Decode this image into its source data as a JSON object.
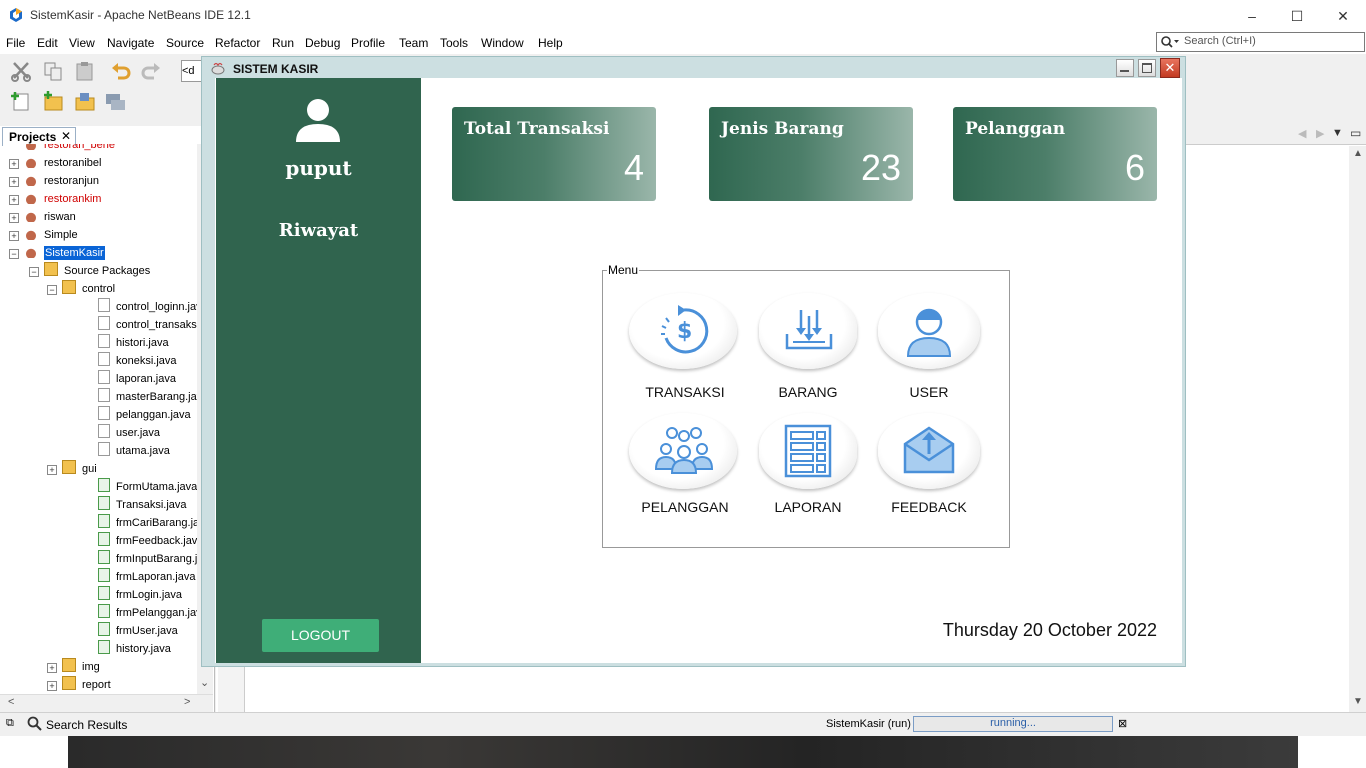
{
  "ide": {
    "title": "SistemKasir - Apache NetBeans IDE 12.1",
    "menu": [
      "File",
      "Edit",
      "View",
      "Navigate",
      "Source",
      "Refactor",
      "Run",
      "Debug",
      "Profile",
      "Team",
      "Tools",
      "Window",
      "Help"
    ],
    "search_placeholder": "Search (Ctrl+I)",
    "toolbar_combo": "<d",
    "projects_tab": "Projects",
    "tree": [
      {
        "label": "restoran_bene",
        "kind": "project",
        "color": "#d00000"
      },
      {
        "label": "restoranibel",
        "kind": "project",
        "color": "#000000"
      },
      {
        "label": "restoranjun",
        "kind": "project",
        "color": "#000000"
      },
      {
        "label": "restorankim",
        "kind": "project-error",
        "color": "#d00000"
      },
      {
        "label": "riswan",
        "kind": "project",
        "color": "#000000"
      },
      {
        "label": "Simple",
        "kind": "project",
        "color": "#000000"
      },
      {
        "label": "SistemKasir",
        "kind": "project-selected",
        "color": "#ffffff"
      },
      {
        "label": "Source Packages",
        "kind": "source",
        "color": "#000000"
      },
      {
        "label": "control",
        "kind": "package",
        "color": "#000000"
      },
      {
        "label": "control_loginn.java",
        "kind": "java",
        "color": "#000000"
      },
      {
        "label": "control_transaksi.ja",
        "kind": "java",
        "color": "#000000"
      },
      {
        "label": "histori.java",
        "kind": "java",
        "color": "#000000"
      },
      {
        "label": "koneksi.java",
        "kind": "java",
        "color": "#000000"
      },
      {
        "label": "laporan.java",
        "kind": "java",
        "color": "#000000"
      },
      {
        "label": "masterBarang.java",
        "kind": "java",
        "color": "#000000"
      },
      {
        "label": "pelanggan.java",
        "kind": "java",
        "color": "#000000"
      },
      {
        "label": "user.java",
        "kind": "java",
        "color": "#000000"
      },
      {
        "label": "utama.java",
        "kind": "java",
        "color": "#000000"
      },
      {
        "label": "gui",
        "kind": "package",
        "color": "#000000"
      },
      {
        "label": "FormUtama.java",
        "kind": "form",
        "color": "#000000"
      },
      {
        "label": "Transaksi.java",
        "kind": "form",
        "color": "#000000"
      },
      {
        "label": "frmCariBarang.java",
        "kind": "form",
        "color": "#000000"
      },
      {
        "label": "frmFeedback.java",
        "kind": "form",
        "color": "#000000"
      },
      {
        "label": "frmInputBarang.jav",
        "kind": "form",
        "color": "#000000"
      },
      {
        "label": "frmLaporan.java",
        "kind": "form",
        "color": "#000000"
      },
      {
        "label": "frmLogin.java",
        "kind": "form",
        "color": "#000000"
      },
      {
        "label": "frmPelanggan.java",
        "kind": "form",
        "color": "#000000"
      },
      {
        "label": "frmUser.java",
        "kind": "form",
        "color": "#000000"
      },
      {
        "label": "history.java",
        "kind": "form",
        "color": "#000000"
      },
      {
        "label": "img",
        "kind": "package",
        "color": "#000000"
      },
      {
        "label": "report",
        "kind": "package",
        "color": "#000000"
      }
    ],
    "status": {
      "search_results": "Search Results",
      "run_label": "SistemKasir (run)",
      "progress_text": "running..."
    }
  },
  "app": {
    "window_title": "SISTEM KASIR",
    "user_name": "puput",
    "riwayat": "Riwayat",
    "logout": "LOGOUT",
    "cards": [
      {
        "title": "Total Transaksi",
        "value": "4"
      },
      {
        "title": "Jenis Barang",
        "value": "23"
      },
      {
        "title": "Pelanggan",
        "value": "6"
      }
    ],
    "menu_legend": "Menu",
    "menu_items": [
      {
        "label": "TRANSAKSI",
        "icon": "dollar-refresh-icon"
      },
      {
        "label": "BARANG",
        "icon": "download-tray-icon"
      },
      {
        "label": "USER",
        "icon": "user-icon"
      },
      {
        "label": "PELANGGAN",
        "icon": "group-icon"
      },
      {
        "label": "LAPORAN",
        "icon": "report-list-icon"
      },
      {
        "label": "FEEDBACK",
        "icon": "envelope-icon"
      }
    ],
    "date": "Thursday 20 October 2022",
    "colors": {
      "sidebar": "#30644e",
      "logout": "#3fae78",
      "icon_blue": "#4a90d9"
    }
  }
}
